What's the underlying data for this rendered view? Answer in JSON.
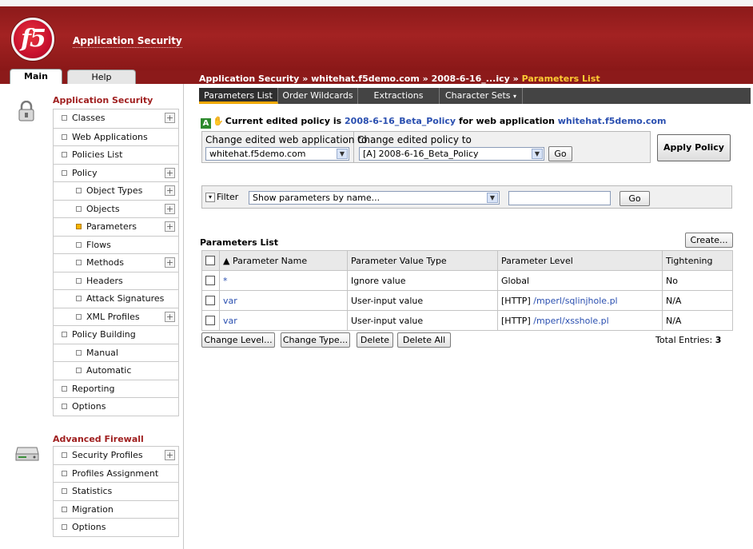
{
  "header": {
    "app_title": "Application Security",
    "logo_text": "f5"
  },
  "tabs": {
    "main": "Main",
    "help": "Help"
  },
  "breadcrumb": {
    "part1": "Application Security",
    "sep": " » ",
    "part2": "whitehat.f5demo.com",
    "part3": "2008-6-16_...icy",
    "current": "Parameters List"
  },
  "sidebar": {
    "app_security_title": "Application Security",
    "app_security_items": [
      {
        "label": "Classes",
        "plus": "+"
      },
      {
        "label": "Web Applications"
      },
      {
        "label": "Policies List"
      },
      {
        "label": "Policy",
        "plus": "+"
      },
      {
        "label": "Object Types",
        "plus": "+"
      },
      {
        "label": "Objects",
        "plus": "+"
      },
      {
        "label": "Parameters",
        "plus": "+"
      },
      {
        "label": "Flows"
      },
      {
        "label": "Methods",
        "plus": "+"
      },
      {
        "label": "Headers"
      },
      {
        "label": "Attack Signatures"
      },
      {
        "label": "XML Profiles",
        "plus": "+"
      },
      {
        "label": "Policy Building"
      },
      {
        "label": "Manual"
      },
      {
        "label": "Automatic"
      },
      {
        "label": "Reporting"
      },
      {
        "label": "Options"
      }
    ],
    "firewall_title": "Advanced Firewall",
    "firewall_items": [
      {
        "label": "Security Profiles",
        "plus": "+"
      },
      {
        "label": "Profiles Assignment"
      },
      {
        "label": "Statistics"
      },
      {
        "label": "Migration"
      },
      {
        "label": "Options"
      }
    ]
  },
  "subnav": {
    "tabs": [
      "Parameters List",
      "Order Wildcards",
      "Extractions",
      "Character Sets"
    ],
    "dropdown_marker": "▾"
  },
  "policy": {
    "badge": "A",
    "hand": "✋",
    "text_before": "Current edited policy is ",
    "policy_name": "2008-6-16_Beta_Policy",
    "text_mid": " for web application ",
    "web_app": "whitehat.f5demo.com",
    "change_webapp_label": "Change edited web application to",
    "change_webapp_value": "whitehat.f5demo.com",
    "change_policy_label": "Change edited policy to",
    "change_policy_value": "[A] 2008-6-16_Beta_Policy",
    "go_label": "Go",
    "apply_label": "Apply Policy"
  },
  "filter": {
    "label": "Filter",
    "toggle": "▾",
    "select_value": "Show parameters by name...",
    "text_value": "",
    "go_label": "Go"
  },
  "params": {
    "title": "Parameters List",
    "create_label": "Create...",
    "columns": [
      "▲ Parameter Name",
      "Parameter Value Type",
      "Parameter Level",
      "Tightening"
    ],
    "rows": [
      {
        "name": "*",
        "value_type": "Ignore value",
        "level_prefix": "",
        "level_link": "",
        "level_text": "Global",
        "tightening": "No"
      },
      {
        "name": "var",
        "value_type": "User-input value",
        "level_prefix": "[HTTP] ",
        "level_link": "/mperl/sqlinjhole.pl",
        "level_text": "",
        "tightening": "N/A"
      },
      {
        "name": "var",
        "value_type": "User-input value",
        "level_prefix": "[HTTP] ",
        "level_link": "/mperl/xsshole.pl",
        "level_text": "",
        "tightening": "N/A"
      }
    ],
    "actions": [
      "Change Level...",
      "Change Type...",
      "Delete",
      "Delete All"
    ],
    "total_label": "Total Entries: ",
    "total_value": "3"
  },
  "colors": {
    "header_red": "#8c1a1a",
    "section_title": "#a02020",
    "link": "#2a4fb0",
    "breadcrumb_current": "#ffcc33",
    "active_tab_underline": "#f0a800"
  }
}
